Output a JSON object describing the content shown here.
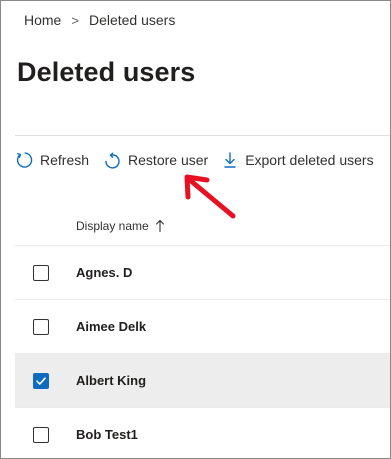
{
  "breadcrumb": {
    "home": "Home",
    "current": "Deleted users",
    "separator": ">"
  },
  "page": {
    "title": "Deleted users"
  },
  "commands": {
    "refresh": "Refresh",
    "restore": "Restore user",
    "export": "Export deleted users"
  },
  "table": {
    "column_header": "Display name",
    "sort": "ascending",
    "rows": [
      {
        "name": "Agnes. D",
        "checked": false
      },
      {
        "name": "Aimee Delk",
        "checked": false
      },
      {
        "name": "Albert King",
        "checked": true
      },
      {
        "name": "Bob Test1",
        "checked": false
      }
    ]
  },
  "colors": {
    "accent": "#0f6cbd",
    "annotation_arrow": "#e81123",
    "selected_row": "#ededed"
  }
}
